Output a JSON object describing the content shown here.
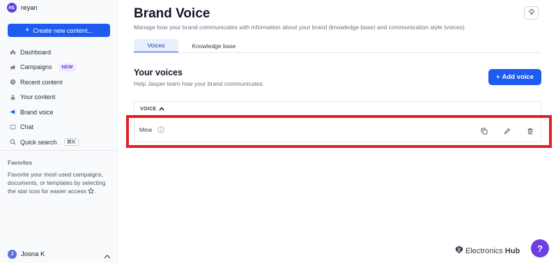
{
  "workspace": {
    "initials": "RE",
    "name": "reyan"
  },
  "sidebar": {
    "create_label": "Create new content...",
    "items": [
      {
        "label": "Dashboard"
      },
      {
        "label": "Campaigns",
        "badge": "NEW"
      },
      {
        "label": "Recent content"
      },
      {
        "label": "Your content"
      },
      {
        "label": "Brand voice"
      },
      {
        "label": "Chat"
      },
      {
        "label": "Quick search",
        "shortcut": "⌘K"
      }
    ],
    "favorites_title": "Favorites",
    "favorites_text": "Favorite your most used campaigns, documents, or templates by selecting the star icon for easier access"
  },
  "user": {
    "initial": "J",
    "name": "Josna K"
  },
  "header": {
    "title": "Brand Voice",
    "subtitle": "Manage how your brand communicates with information about your brand (knowledge base) and communication style (voices)"
  },
  "tabs": [
    {
      "label": "Voices",
      "active": true
    },
    {
      "label": "Knowledge base",
      "active": false
    }
  ],
  "voices": {
    "title": "Your voices",
    "subtitle": "Help Jasper learn how your brand communicates.",
    "add_label": "Add voice",
    "column_header": "VOICE",
    "rows": [
      {
        "name": "Mine"
      }
    ]
  },
  "watermark": {
    "brand": "Electronics",
    "suffix": "Hub"
  },
  "help_label": "?",
  "colors": {
    "primary": "#1e5bf0",
    "highlight": "#e11d26",
    "accent_purple": "#6d3ee0"
  }
}
